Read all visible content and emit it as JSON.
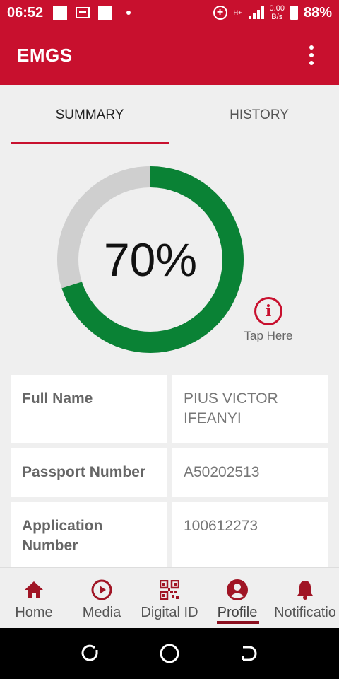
{
  "status_bar": {
    "time": "06:52",
    "network_type": "H+",
    "data_speed_value": "0.00",
    "data_speed_unit": "B/s",
    "battery": "88%"
  },
  "app_bar": {
    "title": "EMGS"
  },
  "tabs": [
    {
      "label": "SUMMARY",
      "active": true
    },
    {
      "label": "HISTORY",
      "active": false
    }
  ],
  "progress": {
    "value": 70,
    "label": "70%",
    "colors": {
      "fill": "#0a8235",
      "track": "#cfcfcf"
    }
  },
  "info": {
    "label": "Tap Here",
    "icon": "info-icon"
  },
  "details": [
    {
      "label": "Full Name",
      "value": "PIUS VICTOR IFEANYI"
    },
    {
      "label": "Passport Number",
      "value": "A50202513"
    },
    {
      "label": "Application Number",
      "value": "100612273"
    }
  ],
  "bottom_nav": [
    {
      "label": "Home",
      "icon": "home-icon",
      "active": false
    },
    {
      "label": "Media",
      "icon": "play-icon",
      "active": false
    },
    {
      "label": "Digital ID",
      "icon": "qr-code-icon",
      "active": false
    },
    {
      "label": "Profile",
      "icon": "person-icon",
      "active": true
    },
    {
      "label": "Notificatio",
      "icon": "bell-icon",
      "active": false
    }
  ],
  "colors": {
    "brand": "#c8102e",
    "nav_icon": "#a01525"
  }
}
